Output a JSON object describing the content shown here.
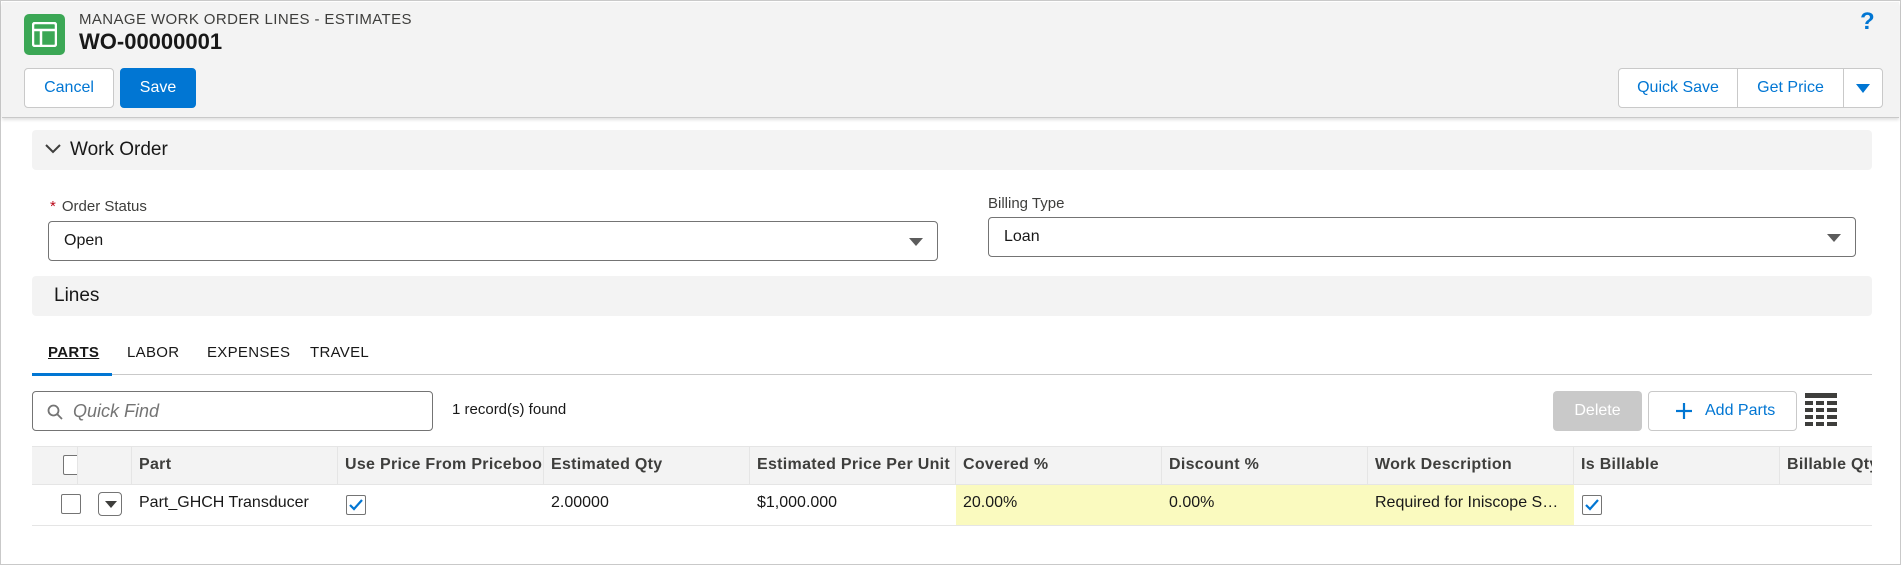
{
  "header": {
    "eyebrow": "MANAGE WORK ORDER LINES - ESTIMATES",
    "title": "WO-00000001",
    "help_label": "?",
    "cancel_label": "Cancel",
    "save_label": "Save",
    "quick_save_label": "Quick Save",
    "get_price_label": "Get Price"
  },
  "work_order_section": {
    "title": "Work Order",
    "order_status": {
      "label": "Order Status",
      "required_marker": "*",
      "value": "Open"
    },
    "billing_type": {
      "label": "Billing Type",
      "value": "Loan"
    }
  },
  "lines_section": {
    "title": "Lines",
    "tabs": [
      {
        "label": "PARTS",
        "active": true
      },
      {
        "label": "LABOR",
        "active": false
      },
      {
        "label": "EXPENSES",
        "active": false
      },
      {
        "label": "TRAVEL",
        "active": false
      }
    ],
    "search_placeholder": "Quick Find",
    "record_count": "1 record(s) found",
    "delete_label": "Delete",
    "add_parts_label": "Add Parts"
  },
  "table": {
    "columns": [
      "Part",
      "Use Price From Pricebook",
      "Estimated Qty",
      "Estimated Price Per Unit",
      "Covered %",
      "Discount %",
      "Work Description",
      "Is Billable",
      "Billable Qty"
    ],
    "rows": [
      {
        "part": "Part_GHCH Transducer",
        "use_price_from_pricebook": true,
        "estimated_qty": "2.00000",
        "estimated_price_per_unit": "$1,000.000",
        "covered_pct": "20.00%",
        "discount_pct": "0.00%",
        "work_description": "Required for Iniscope System",
        "is_billable": true
      }
    ]
  },
  "colors": {
    "brand": "#0176d3",
    "app_icon": "#3ba755",
    "edited_cell": "#fafabf",
    "disabled_button": "#c9c9c9"
  },
  "icons": [
    "table-app-icon",
    "help-icon",
    "chevron-down-icon",
    "search-icon",
    "plus-icon",
    "grid-settings-icon",
    "checkmark-icon",
    "caret-down-icon"
  ]
}
